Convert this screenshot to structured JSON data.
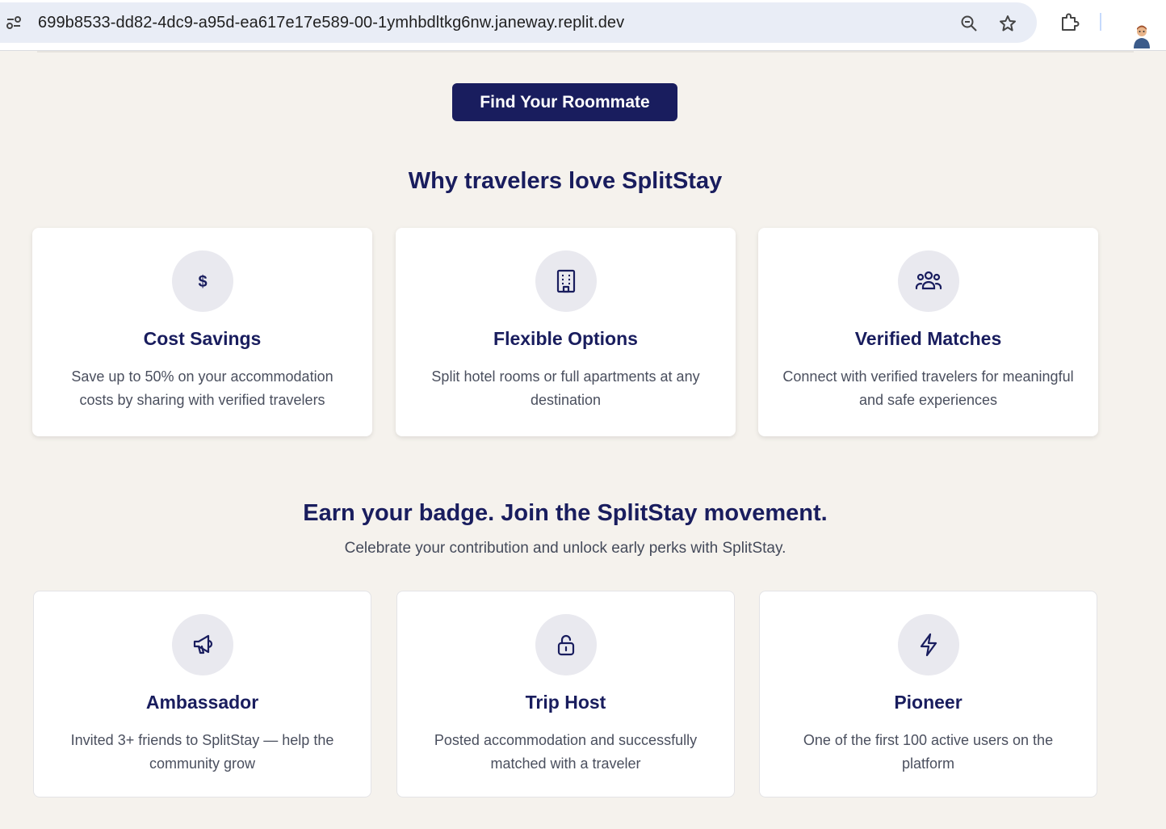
{
  "browser": {
    "url": "699b8533-dd82-4dc9-a95d-ea617e17e589-00-1ymhbdltkg6nw.janeway.replit.dev",
    "icons": [
      "site-info-icon",
      "zoom-icon",
      "bookmark-star-icon",
      "extensions-icon",
      "profile-avatar"
    ]
  },
  "cta": {
    "label": "Find Your Roommate"
  },
  "why": {
    "title": "Why travelers love SplitStay",
    "cards": [
      {
        "icon": "dollar-icon",
        "title": "Cost Savings",
        "desc": "Save up to 50% on your accommodation costs by sharing with verified travelers"
      },
      {
        "icon": "building-icon",
        "title": "Flexible Options",
        "desc": "Split hotel rooms or full apartments at any destination"
      },
      {
        "icon": "users-icon",
        "title": "Verified Matches",
        "desc": "Connect with verified travelers for meaningful and safe experiences"
      }
    ]
  },
  "badges": {
    "title": "Earn your badge. Join the SplitStay movement.",
    "subtitle": "Celebrate your contribution and unlock early perks with SplitStay.",
    "cards": [
      {
        "icon": "megaphone-icon",
        "title": "Ambassador",
        "desc": "Invited 3+ friends to SplitStay — help the community grow"
      },
      {
        "icon": "unlock-icon",
        "title": "Trip Host",
        "desc": "Posted accommodation and successfully matched with a traveler"
      },
      {
        "icon": "lightning-icon",
        "title": "Pioneer",
        "desc": "One of the first 100 active users on the platform"
      }
    ]
  },
  "colors": {
    "navy": "#191d5e",
    "page_bg": "#f5f2ed",
    "icon_bg": "#e9e9ef",
    "body_text": "#4a4f5e"
  }
}
